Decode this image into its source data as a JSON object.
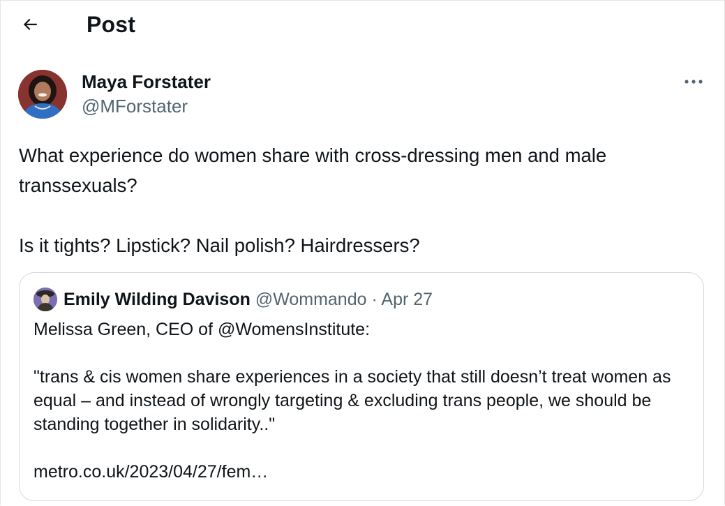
{
  "header": {
    "title": "Post",
    "back_icon": "arrow-left-icon"
  },
  "post": {
    "author_name": "Maya Forstater",
    "author_handle": "@MForstater",
    "more_icon": "more-horizontal-icon",
    "text_line1": "What experience do women share with cross-dressing men and male transsexuals?",
    "text_line2": "Is it tights? Lipstick? Nail polish? Hairdressers?"
  },
  "quote": {
    "author_name": "Emily Wilding Davison",
    "author_handle": "@Wommando",
    "separator": "·",
    "date": "Apr 27",
    "line1": "Melissa Green, CEO of @WomensInstitute:",
    "line2": "\"trans & cis women share experiences in a society that still doesn’t treat women as equal – and instead of wrongly targeting & excluding trans people, we should be standing together in solidarity..\"",
    "link": "metro.co.uk/2023/04/27/fem…"
  },
  "colors": {
    "text_primary": "#0f1419",
    "text_secondary": "#536471",
    "border": "#cfd9de"
  }
}
